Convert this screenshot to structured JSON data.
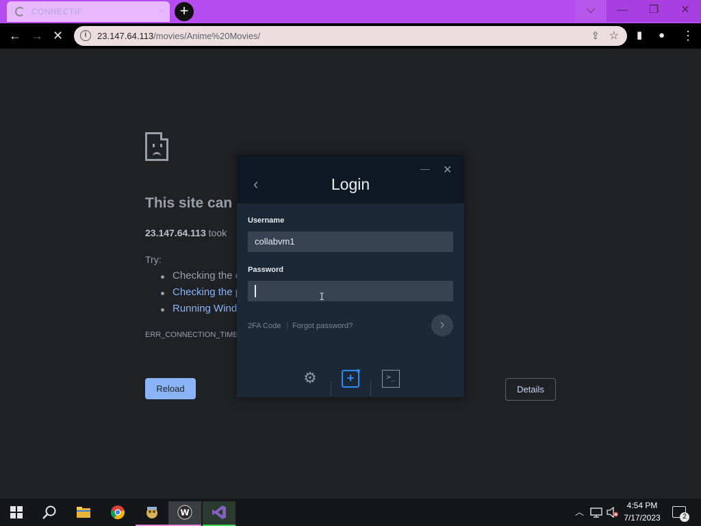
{
  "browser": {
    "tab_title": "CONNECTIF",
    "tab_close": "×",
    "new_tab": "+",
    "window_buttons": {
      "tab_search": "⌵",
      "minimize": "—",
      "restore": "❐",
      "close": "✕"
    },
    "nav": {
      "back": "←",
      "forward": "→",
      "stop": "✕"
    },
    "url_host": "23.147.64.113",
    "url_path": "/movies/Anime%20Movies/",
    "address_info": "i",
    "share": "⇪",
    "bookmark": "☆",
    "side_panel": "▮",
    "profile": "●",
    "menu": "⋮"
  },
  "error_page": {
    "title": "This site can",
    "detail_host": "23.147.64.113",
    "detail_rest": " took",
    "try_label": "Try:",
    "suggestions": [
      "Checking the c",
      "Checking the p",
      "Running Wind"
    ],
    "error_code": "ERR_CONNECTION_TIMEI",
    "reload_label": "Reload",
    "details_label": "Details"
  },
  "login_dialog": {
    "title": "Login",
    "back_icon": "‹",
    "minimize_icon": "—",
    "close_icon": "✕",
    "username_label": "Username",
    "username_value": "collabvm1",
    "password_label": "Password",
    "password_value": "",
    "twofa_link": "2FA Code",
    "separator": "|",
    "forgot_link": "Forgot password?",
    "submit_icon": "›",
    "settings_icon": "⚙",
    "add_icon": "+",
    "terminal_icon": ">_",
    "cursor": "I"
  },
  "taskbar": {
    "time": "4:54 PM",
    "date": "7/17/2023",
    "notification_count": "2",
    "tray_chevron": "︿",
    "apps": [
      {
        "name": "search",
        "bar_color": ""
      },
      {
        "name": "file-explorer",
        "bar_color": ""
      },
      {
        "name": "chrome",
        "bar_color": ""
      },
      {
        "name": "app-pink",
        "bar_color": "#f08be0"
      },
      {
        "name": "app-w",
        "bar_color": "#f08be0"
      },
      {
        "name": "visual-studio",
        "bar_color": "#3fd35a"
      }
    ]
  },
  "colors": {
    "tab_bar": "#b74cf0",
    "page_bg": "#202124",
    "link": "#8ab4f8",
    "dialog_bg": "#1b2838",
    "accent_blue": "#2a8bf2"
  }
}
